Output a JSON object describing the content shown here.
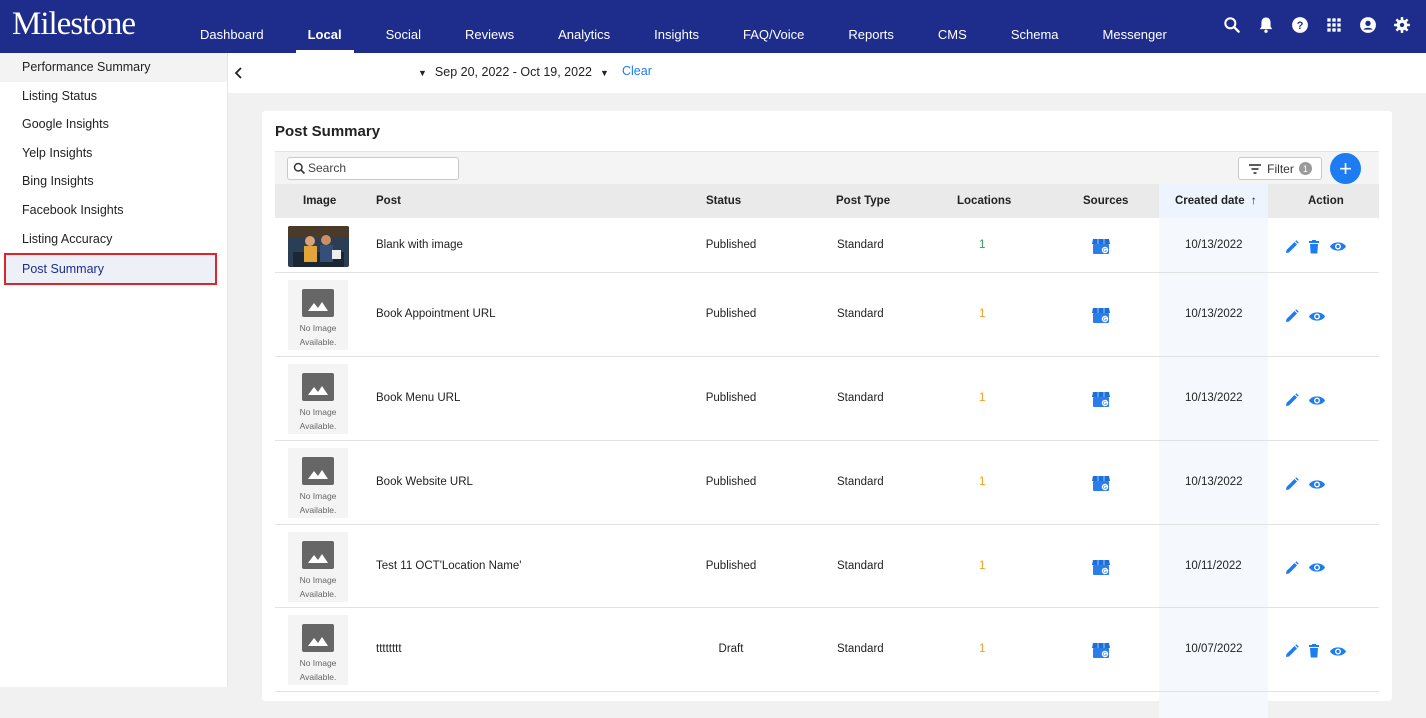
{
  "app": {
    "logo": "Milestone"
  },
  "nav": [
    {
      "label": "Dashboard",
      "active": false
    },
    {
      "label": "Local",
      "active": true
    },
    {
      "label": "Social",
      "active": false
    },
    {
      "label": "Reviews",
      "active": false
    },
    {
      "label": "Analytics",
      "active": false
    },
    {
      "label": "Insights",
      "active": false
    },
    {
      "label": "FAQ/Voice",
      "active": false
    },
    {
      "label": "Reports",
      "active": false
    },
    {
      "label": "CMS",
      "active": false
    },
    {
      "label": "Schema",
      "active": false
    },
    {
      "label": "Messenger",
      "active": false
    }
  ],
  "top_icons": [
    "search-icon",
    "bell-icon",
    "help-icon",
    "apps-grid-icon",
    "account-icon",
    "settings-icon"
  ],
  "sidebar": {
    "items": [
      {
        "label": "Performance Summary"
      },
      {
        "label": "Listing Status"
      },
      {
        "label": "Google Insights"
      },
      {
        "label": "Yelp Insights"
      },
      {
        "label": "Bing Insights"
      },
      {
        "label": "Facebook Insights"
      },
      {
        "label": "Listing Accuracy"
      },
      {
        "label": "Post Summary",
        "active": true
      }
    ]
  },
  "datebar": {
    "range": "Sep 20, 2022 - Oct 19, 2022",
    "clear": "Clear"
  },
  "card": {
    "title": "Post Summary",
    "search_placeholder": "Search",
    "filter_label": "Filter",
    "filter_count": "1",
    "add_label": "+"
  },
  "table": {
    "headers": {
      "image": "Image",
      "post": "Post",
      "status": "Status",
      "post_type": "Post Type",
      "locations": "Locations",
      "sources": "Sources",
      "created_date": "Created date",
      "sort_arrow": "↑",
      "action": "Action"
    },
    "no_image_text_1": "No Image",
    "no_image_text_2": "Available.",
    "rows": [
      {
        "post": "Blank with image",
        "status": "Published",
        "post_type": "Standard",
        "locations": "1",
        "created": "10/13/2022",
        "has_image": true,
        "has_delete": true,
        "location_color": "green"
      },
      {
        "post": "Book Appointment URL",
        "status": "Published",
        "post_type": "Standard",
        "locations": "1",
        "created": "10/13/2022",
        "has_image": false,
        "has_delete": false,
        "location_color": "orange"
      },
      {
        "post": "Book Menu URL",
        "status": "Published",
        "post_type": "Standard",
        "locations": "1",
        "created": "10/13/2022",
        "has_image": false,
        "has_delete": false,
        "location_color": "orange"
      },
      {
        "post": "Book Website URL",
        "status": "Published",
        "post_type": "Standard",
        "locations": "1",
        "created": "10/13/2022",
        "has_image": false,
        "has_delete": false,
        "location_color": "orange"
      },
      {
        "post": "Test 11 OCT'Location Name'",
        "status": "Published",
        "post_type": "Standard",
        "locations": "1",
        "created": "10/11/2022",
        "has_image": false,
        "has_delete": false,
        "location_color": "orange"
      },
      {
        "post": "tttttttt",
        "status": "Draft",
        "post_type": "Standard",
        "locations": "1",
        "created": "10/07/2022",
        "has_image": false,
        "has_delete": true,
        "location_color": "orange"
      }
    ]
  },
  "colors": {
    "nav_bg": "#1e2d8c",
    "accent": "#1d7cf2",
    "highlight_border": "#e0242b",
    "location_green": "#2e9e53",
    "location_orange": "#f0a020"
  }
}
